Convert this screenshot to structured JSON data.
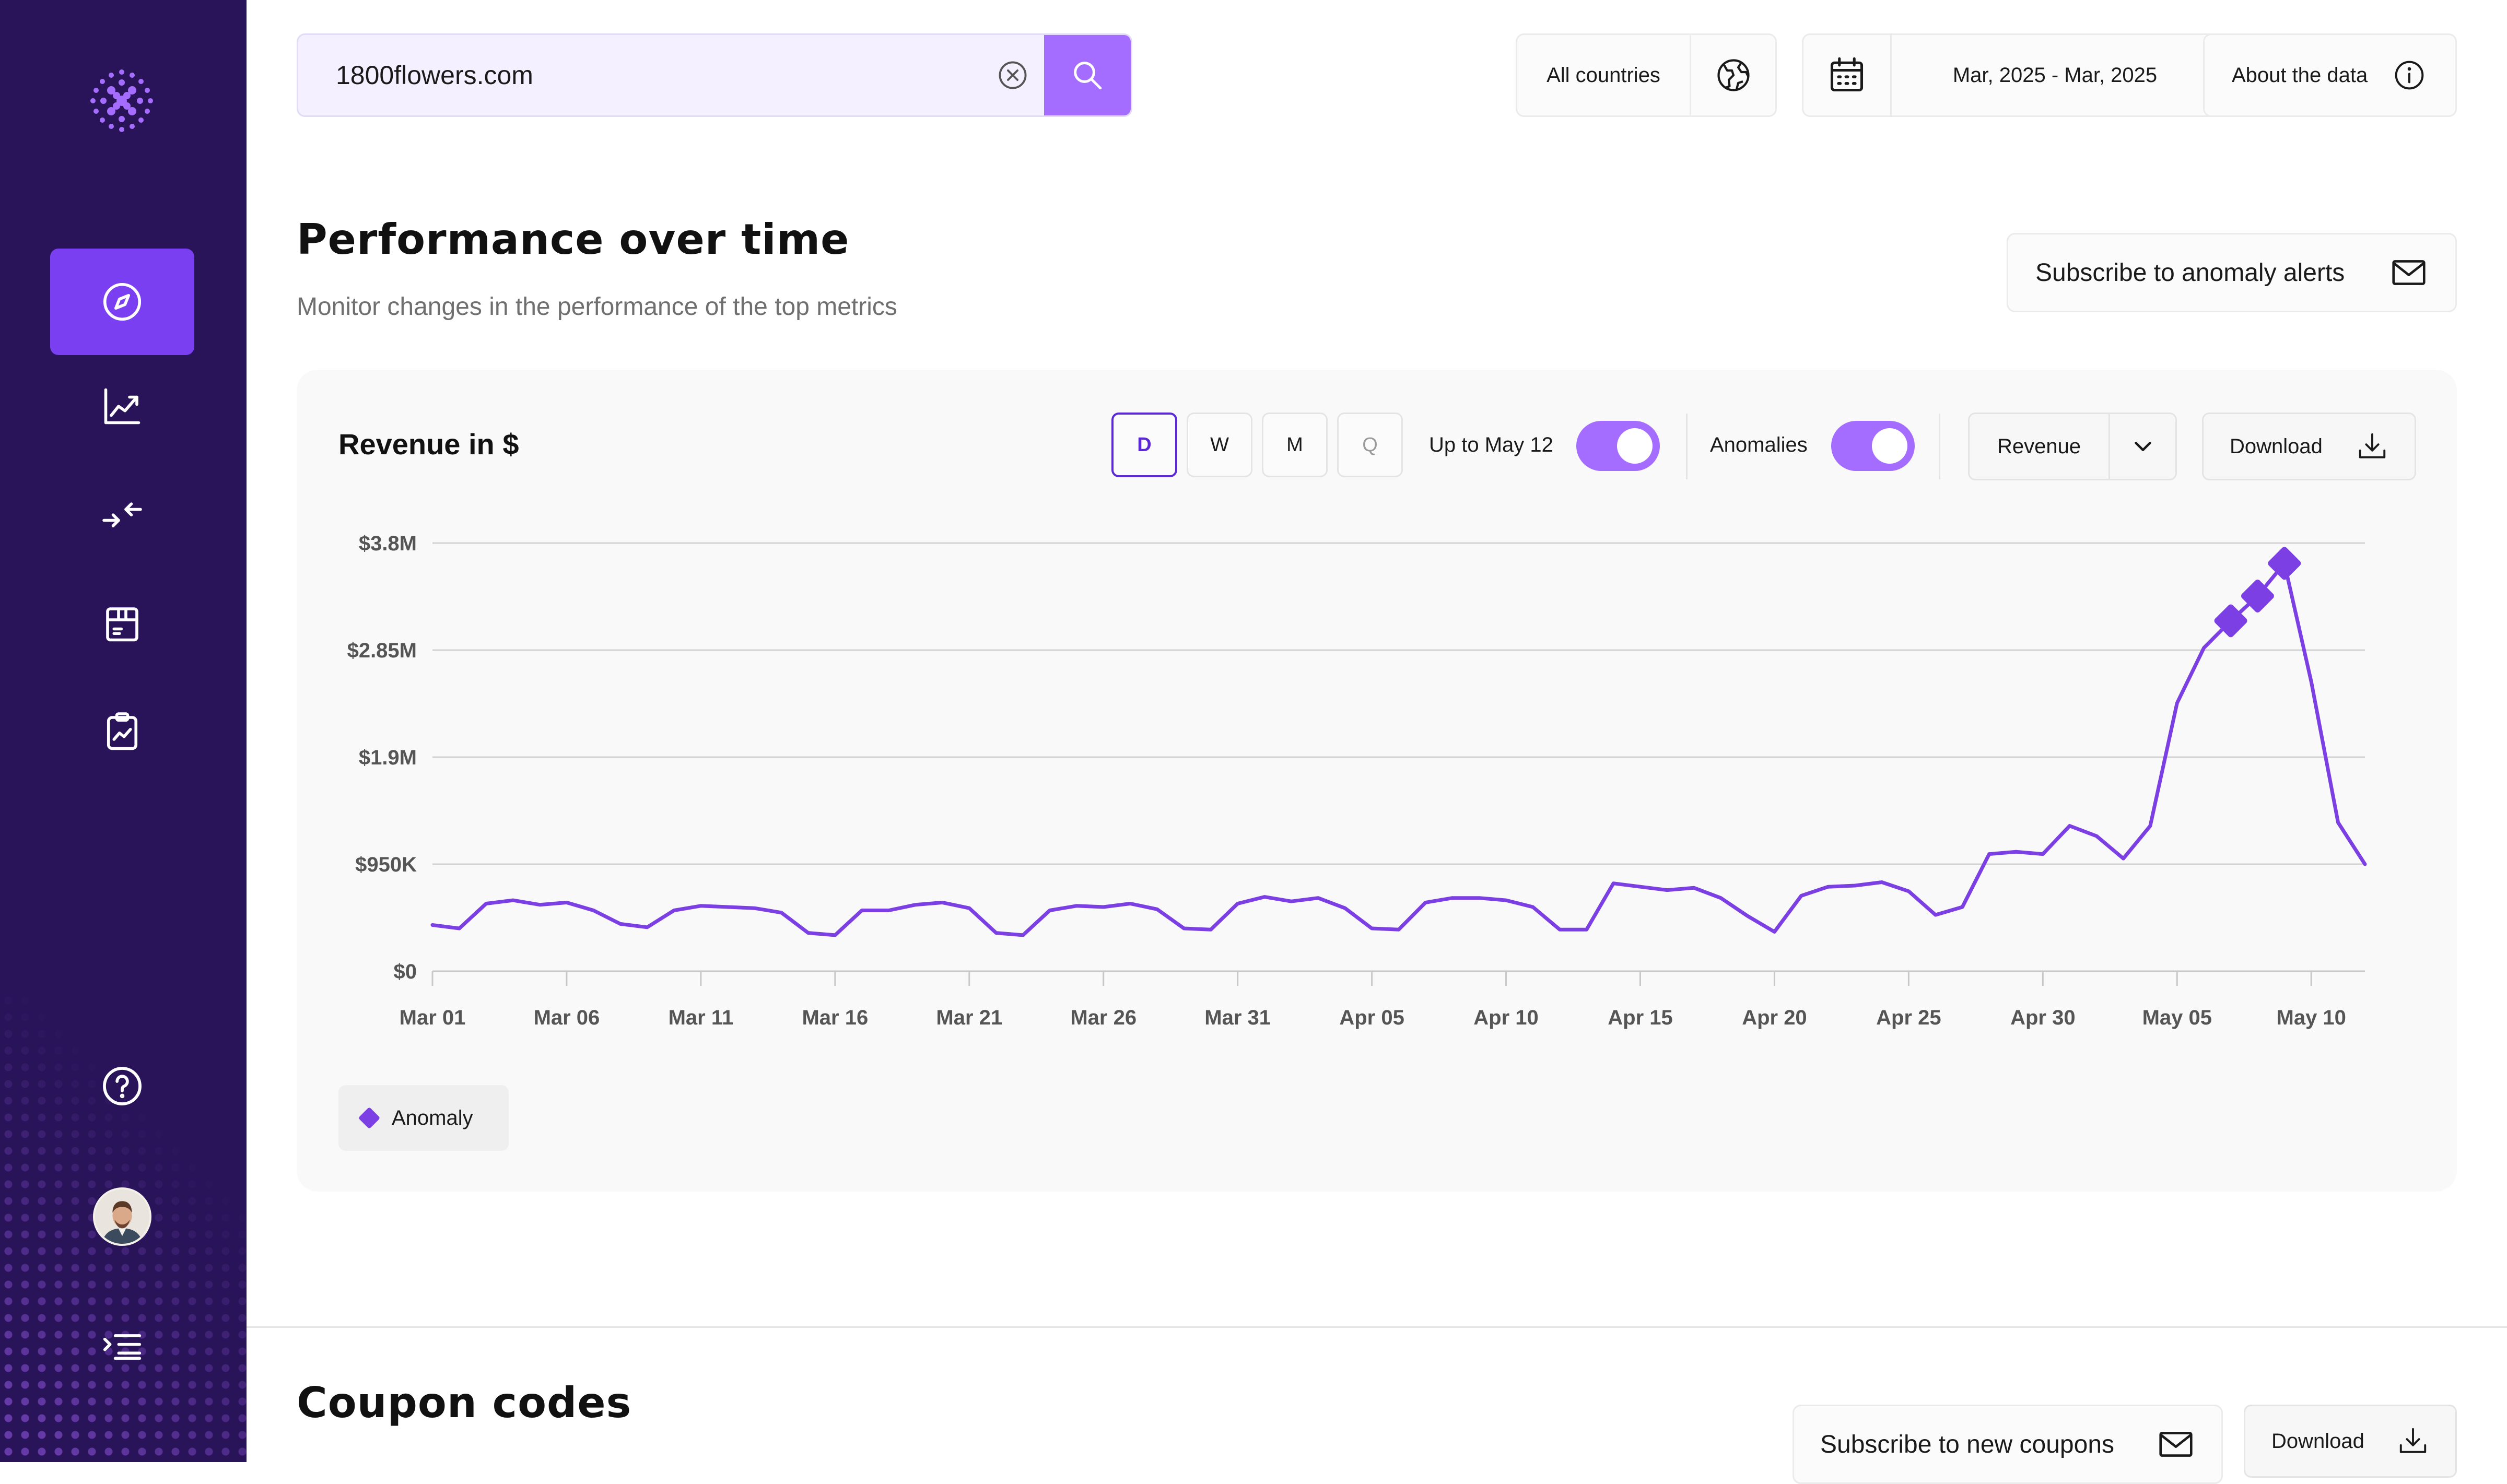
{
  "sidebar": {
    "logo": "brand-logo",
    "items": [
      {
        "name": "explore",
        "icon": "compass-icon",
        "active": true
      },
      {
        "name": "trends",
        "icon": "line-chart-icon",
        "active": false
      },
      {
        "name": "compare",
        "icon": "arrows-compare-icon",
        "active": false
      },
      {
        "name": "products",
        "icon": "box-icon",
        "active": false
      },
      {
        "name": "reports",
        "icon": "clipboard-chart-icon",
        "active": false
      }
    ],
    "help_icon": "help-icon",
    "avatar": "user-avatar",
    "collapse_icon": "menu-collapse-icon"
  },
  "search": {
    "value": "1800flowers.com",
    "placeholder": ""
  },
  "header": {
    "country_label": "All countries",
    "date_range": "Mar, 2025 - Mar, 2025",
    "about_label": "About the data"
  },
  "performance": {
    "title": "Performance over time",
    "subtitle": "Monitor changes in the performance of the top metrics",
    "subscribe_label": "Subscribe to anomaly alerts"
  },
  "chart_card": {
    "title": "Revenue in $",
    "granularity": [
      "D",
      "W",
      "M",
      "Q"
    ],
    "granularity_selected": "D",
    "upto_label": "Up to May 12",
    "upto_on": true,
    "anomalies_label": "Anomalies",
    "anomalies_on": true,
    "metric_label": "Revenue",
    "download_label": "Download",
    "legend_label": "Anomaly"
  },
  "coupons": {
    "title": "Coupon codes",
    "subscribe_label": "Subscribe to new coupons",
    "download_label": "Download"
  },
  "colors": {
    "sidebar": "#2a1459",
    "accent": "#7b3fe4",
    "accent_light": "#a56dff"
  },
  "chart_data": {
    "type": "line",
    "title": "",
    "xlabel": "",
    "ylabel": "",
    "ylim": [
      0,
      3800000
    ],
    "yticks": [
      {
        "value": 0,
        "label": "$0"
      },
      {
        "value": 950000,
        "label": "$950K"
      },
      {
        "value": 1900000,
        "label": "$1.9M"
      },
      {
        "value": 2850000,
        "label": "$2.85M"
      },
      {
        "value": 3800000,
        "label": "$3.8M"
      }
    ],
    "xticks": [
      {
        "index": 0,
        "label": "Mar 01"
      },
      {
        "index": 5,
        "label": "Mar 06"
      },
      {
        "index": 10,
        "label": "Mar 11"
      },
      {
        "index": 15,
        "label": "Mar 16"
      },
      {
        "index": 20,
        "label": "Mar 21"
      },
      {
        "index": 25,
        "label": "Mar 26"
      },
      {
        "index": 30,
        "label": "Mar 31"
      },
      {
        "index": 35,
        "label": "Apr 05"
      },
      {
        "index": 40,
        "label": "Apr 10"
      },
      {
        "index": 45,
        "label": "Apr 15"
      },
      {
        "index": 50,
        "label": "Apr 20"
      },
      {
        "index": 55,
        "label": "Apr 25"
      },
      {
        "index": 60,
        "label": "Apr 30"
      },
      {
        "index": 65,
        "label": "May 05"
      },
      {
        "index": 70,
        "label": "May 10"
      }
    ],
    "x_start": "2025-03-01",
    "series": [
      {
        "values": [
          410000,
          380000,
          600000,
          630000,
          590000,
          610000,
          540000,
          420000,
          390000,
          540000,
          580000,
          570000,
          560000,
          520000,
          340000,
          320000,
          540000,
          540000,
          590000,
          610000,
          560000,
          340000,
          320000,
          540000,
          580000,
          570000,
          600000,
          550000,
          380000,
          370000,
          600000,
          660000,
          620000,
          650000,
          560000,
          380000,
          370000,
          610000,
          650000,
          650000,
          630000,
          570000,
          370000,
          370000,
          780000,
          750000,
          720000,
          740000,
          650000,
          490000,
          350000,
          670000,
          750000,
          760000,
          790000,
          710000,
          500000,
          570000,
          1040000,
          1060000,
          1040000,
          1290000,
          1200000,
          1000000,
          1290000,
          2380000,
          2870000,
          3110000,
          3330000,
          3620000,
          2570000,
          1320000,
          950000
        ],
        "anomalies": [
          67,
          68,
          69
        ]
      }
    ],
    "grid": true,
    "legend": "bottom-left"
  }
}
